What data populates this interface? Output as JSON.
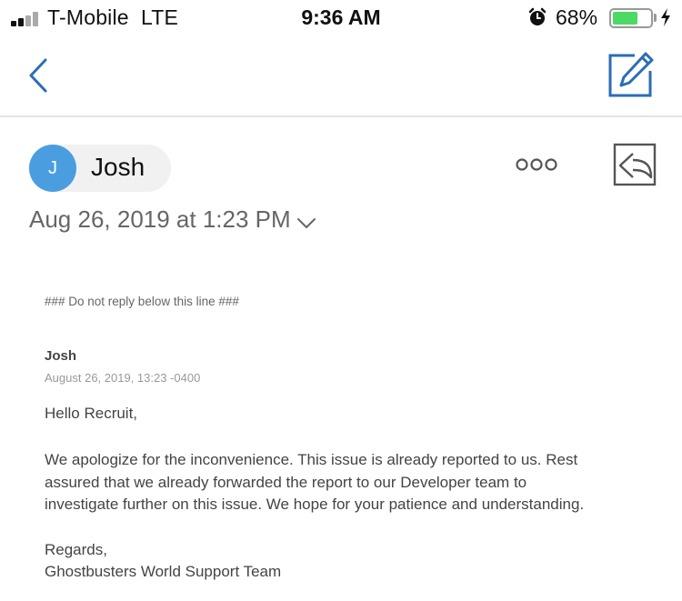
{
  "status_bar": {
    "carrier": "T-Mobile",
    "network": "LTE",
    "time": "9:36 AM",
    "battery_percent": "68%",
    "battery_level": 0.68,
    "battery_color": "#4cd964",
    "icons": [
      "signal-icon",
      "alarm-icon",
      "battery-icon",
      "charging-bolt-icon"
    ]
  },
  "nav": {
    "back_icon": "chevron-left-icon",
    "compose_icon": "compose-icon",
    "accent_color": "#2a6db5"
  },
  "header": {
    "avatar_initial": "J",
    "avatar_color": "#4a9ee0",
    "sender_name": "Josh",
    "date": "Aug 26, 2019 at 1:23 PM",
    "more_icon": "more-dots-icon",
    "reply_icon": "reply-icon",
    "expand_icon": "chevron-down-icon"
  },
  "message": {
    "notice": "### Do not reply below this line ###",
    "quoted_sender": "Josh",
    "quoted_date": "August 26, 2019, 13:23 -0400",
    "greeting": "Hello Recruit,",
    "body_lines": [
      "We apologize for the inconvenience. This issue is already reported to us. Rest",
      "assured that we already forwarded the report to our Developer team to",
      "investigate further on this issue. We hope for your patience and understanding."
    ],
    "signoff_lines": [
      "Regards,",
      "Ghostbusters World Support Team"
    ]
  }
}
